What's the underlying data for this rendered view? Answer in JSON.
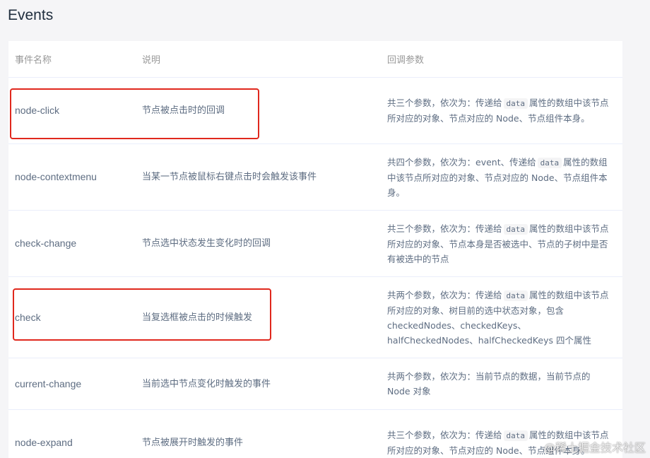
{
  "page": {
    "title": "Events"
  },
  "table": {
    "headers": [
      "事件名称",
      "说明",
      "回调参数"
    ],
    "rows": [
      {
        "name": "node-click",
        "desc": "节点被点击时的回调",
        "params": [
          "共三个参数，依次为：传递给",
          "data",
          "属性的数组中该节点所对应的对象、节点对应的 Node、节点组件本身。"
        ]
      },
      {
        "name": "node-contextmenu",
        "desc": "当某一节点被鼠标右键点击时会触发该事件",
        "params": [
          "共四个参数，依次为：event、传递给",
          "data",
          "属性的数组中该节点所对应的对象、节点对应的 Node、节点组件本身。"
        ]
      },
      {
        "name": "check-change",
        "desc": "节点选中状态发生变化时的回调",
        "params": [
          "共三个参数，依次为：传递给",
          "data",
          "属性的数组中该节点所对应的对象、节点本身是否被选中、节点的子树中是否有被选中的节点"
        ]
      },
      {
        "name": "check",
        "desc": "当复选框被点击的时候触发",
        "params": [
          "共两个参数，依次为：传递给",
          "data",
          "属性的数组中该节点所对应的对象、树目前的选中状态对象，包含 checkedNodes、checkedKeys、halfCheckedNodes、halfCheckedKeys 四个属性"
        ]
      },
      {
        "name": "current-change",
        "desc": "当前选中节点变化时触发的事件",
        "params": [
          "共两个参数，依次为：当前节点的数据，当前节点的 Node 对象",
          "",
          ""
        ]
      },
      {
        "name": "node-expand",
        "desc": "节点被展开时触发的事件",
        "params": [
          "共三个参数，依次为：传递给",
          "data",
          "属性的数组中该节点所对应的对象、节点对应的 Node、节点组件本身。"
        ]
      }
    ]
  },
  "watermark": "@稀土掘金技术社区",
  "colors": {
    "highlight": "#e0281d",
    "code_bg": "#f4f4f5",
    "text": "#5e6d82"
  }
}
